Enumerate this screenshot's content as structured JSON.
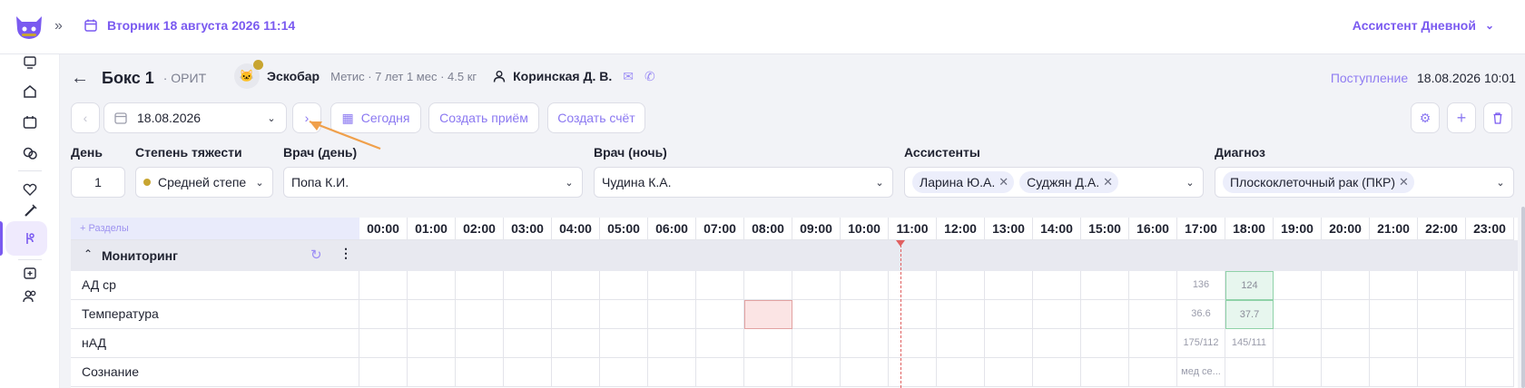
{
  "topbar": {
    "date": "Вторник 18 августа 2026 11:14",
    "user": "Ассистент Дневной"
  },
  "header": {
    "box": "Бокс 1",
    "unit": "· ОРИТ",
    "pet_name": "Эскобар",
    "pet_info": "Метис · 7 лет 1 мес · 4.5 кг",
    "owner": "Коринская Д. В.",
    "admission_label": "Поступление",
    "admission_value": "18.08.2026 10:01"
  },
  "toolbar": {
    "date_value": "18.08.2026",
    "today": "Сегодня",
    "create_visit": "Создать приём",
    "create_invoice": "Создать счёт"
  },
  "fields": {
    "day_label": "День",
    "day_value": "1",
    "severity_label": "Степень тяжести",
    "severity_value": "Средней степе",
    "doctor_day_label": "Врач (день)",
    "doctor_day_value": "Попа К.И.",
    "doctor_night_label": "Врач (ночь)",
    "doctor_night_value": "Чудина К.А.",
    "assistants_label": "Ассистенты",
    "assistants": [
      "Ларина Ю.А.",
      "Суджян Д.А."
    ],
    "diagnosis_label": "Диагноз",
    "diagnosis": [
      "Плоскоклеточный рак (ПКР)"
    ]
  },
  "grid": {
    "sections_label": "+ Разделы",
    "hours": [
      "00:00",
      "01:00",
      "02:00",
      "03:00",
      "04:00",
      "05:00",
      "06:00",
      "07:00",
      "08:00",
      "09:00",
      "10:00",
      "11:00",
      "12:00",
      "13:00",
      "14:00",
      "15:00",
      "16:00",
      "17:00",
      "18:00",
      "19:00",
      "20:00",
      "21:00",
      "22:00",
      "23:00"
    ],
    "group_title": "Мониторинг",
    "rows": [
      {
        "label": "АД ср",
        "values": {
          "17": "136",
          "18": "124"
        }
      },
      {
        "label": "Температура",
        "values": {
          "17": "36.6",
          "18": "37.7"
        }
      },
      {
        "label": "нАД",
        "values": {
          "17": "175/112",
          "18": "145/111"
        }
      },
      {
        "label": "Сознание",
        "values": {
          "17": "мед се..."
        }
      }
    ]
  },
  "colors": {
    "accent": "#7a5af0",
    "warning_dot": "#c8a531",
    "now_line": "#e06060",
    "arrow": "#f0a04b"
  }
}
